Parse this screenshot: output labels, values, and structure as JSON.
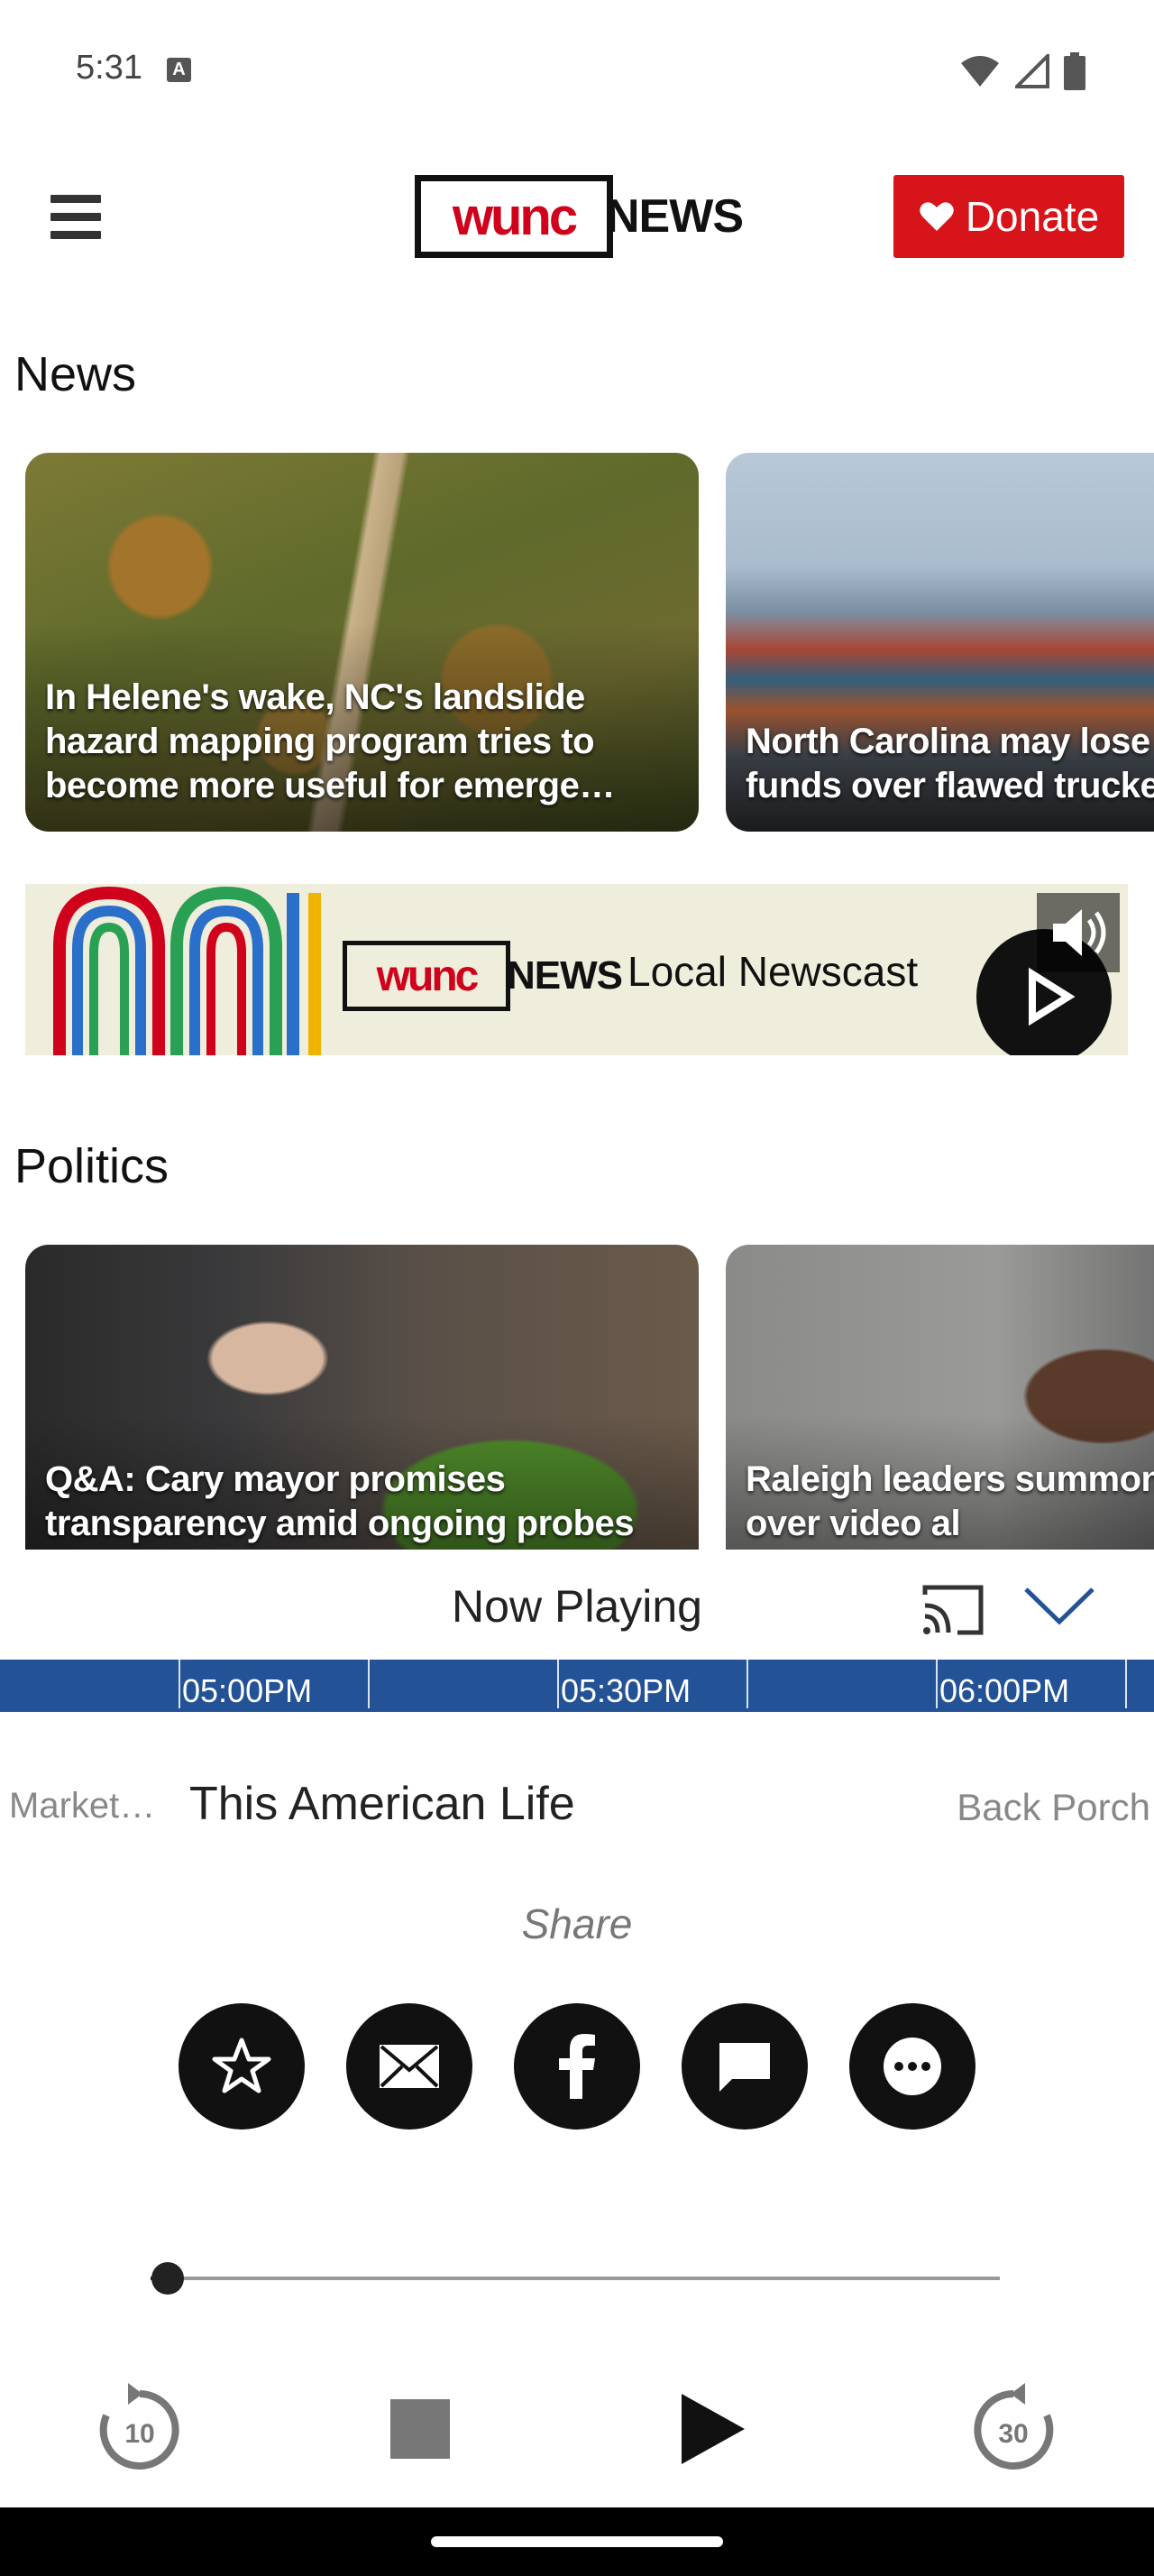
{
  "status_bar": {
    "time": "5:31",
    "notification_icon": "a-icon",
    "icons": [
      "wifi-icon",
      "cell-signal-icon",
      "battery-icon"
    ]
  },
  "header": {
    "menu_icon": "hamburger-menu-icon",
    "logo_wunc": "wunc",
    "logo_news": "NEWS",
    "donate_label": "Donate",
    "donate_icon": "heart-icon",
    "brand_red": "#d7141a"
  },
  "sections": [
    {
      "title": "News",
      "cards": [
        {
          "caption": "In Helene's wake, NC's landslide hazard mapping program tries to become more useful for emerge…"
        },
        {
          "caption": "North Carolina may lose federal funds over flawed trucker licenses"
        }
      ]
    },
    {
      "title": "Politics",
      "cards": [
        {
          "caption": "Q&A: Cary mayor promises transparency amid ongoing probes"
        },
        {
          "caption": "Raleigh leaders summon legislature over video al"
        }
      ]
    }
  ],
  "banner": {
    "logo_wunc": "wunc",
    "logo_news": "NEWS",
    "text": "Local Newscast",
    "play_icon": "play-icon",
    "mute_icon": "volume-icon"
  },
  "now_playing": {
    "title": "Now Playing",
    "cast_icon": "cast-icon",
    "collapse_icon": "chevron-down-icon",
    "timeline_color": "#235296",
    "timeline_labels": [
      "05:00PM",
      "05:30PM",
      "06:00PM"
    ],
    "previous_show": "Market…",
    "current_show": "This American Life",
    "next_show": "Back Porch",
    "share_label": "Share",
    "share_buttons": [
      "star-icon",
      "email-icon",
      "facebook-icon",
      "message-icon",
      "more-icon"
    ],
    "progress": 0.02,
    "controls": {
      "rewind_label": "10",
      "forward_label": "30"
    }
  }
}
